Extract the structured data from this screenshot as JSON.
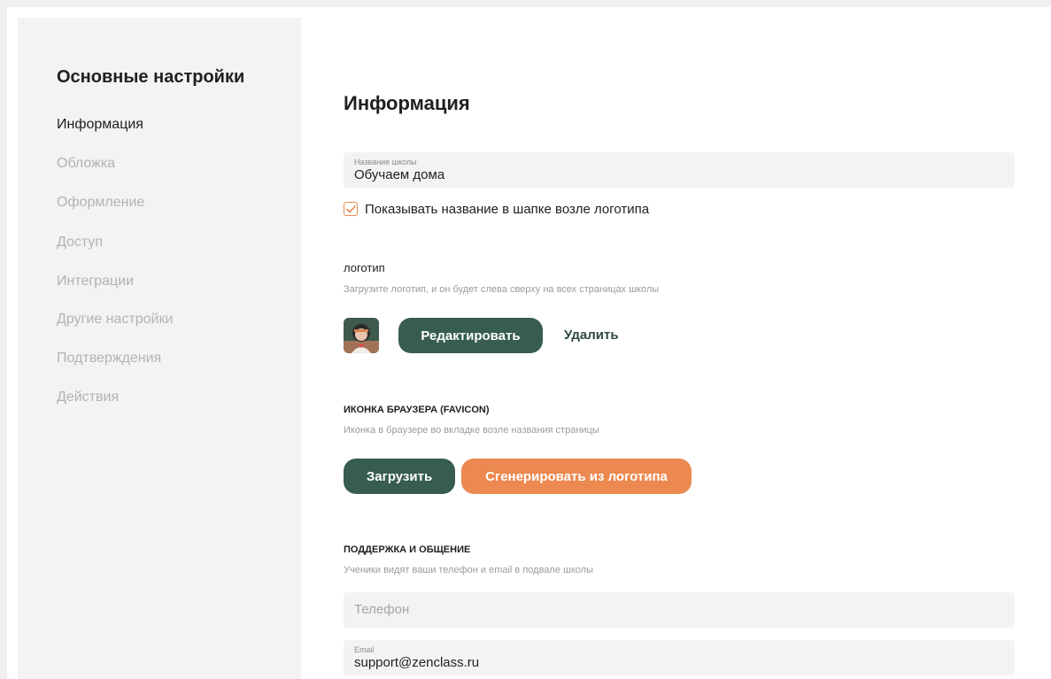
{
  "sidebar": {
    "title": "Основные настройки",
    "items": [
      {
        "label": "Информация",
        "active": true
      },
      {
        "label": "Обложка",
        "active": false
      },
      {
        "label": "Оформление",
        "active": false
      },
      {
        "label": "Доступ",
        "active": false
      },
      {
        "label": "Интеграции",
        "active": false
      },
      {
        "label": "Другие настройки",
        "active": false
      },
      {
        "label": "Подтверждения",
        "active": false
      },
      {
        "label": "Действия",
        "active": false
      }
    ]
  },
  "main": {
    "title": "Информация",
    "school_name": {
      "label": "Название школы",
      "value": "Обучаем дома"
    },
    "show_name_checkbox": {
      "label": "Показывать название в шапке возле логотипа",
      "checked": true
    },
    "logo": {
      "title": "логотип",
      "description": "Загрузите логотип, и он будет слева сверху на всех страницах школы",
      "edit_label": "Редактировать",
      "delete_label": "Удалить",
      "thumbnail_icon": "avatar-logo"
    },
    "favicon": {
      "title": "ИКОНКА БРАУЗЕРА (FAVICON)",
      "description": "Иконка в браузере во вкладке возле названия страницы",
      "upload_label": "Загрузить",
      "generate_label": "Сгенерировать из логотипа"
    },
    "support": {
      "title": "ПОДДЕРЖКА И ОБЩЕНИЕ",
      "description": "Ученики видят ваши телефон и email в подвале школы",
      "phone_placeholder": "Телефон",
      "email_label": "Email",
      "email_value": "support@zenclass.ru"
    }
  },
  "colors": {
    "accent_green": "#365d4d",
    "accent_orange": "#ec8950",
    "sidebar_bg": "#f3f3f3",
    "muted_text": "#b3b3b3"
  }
}
